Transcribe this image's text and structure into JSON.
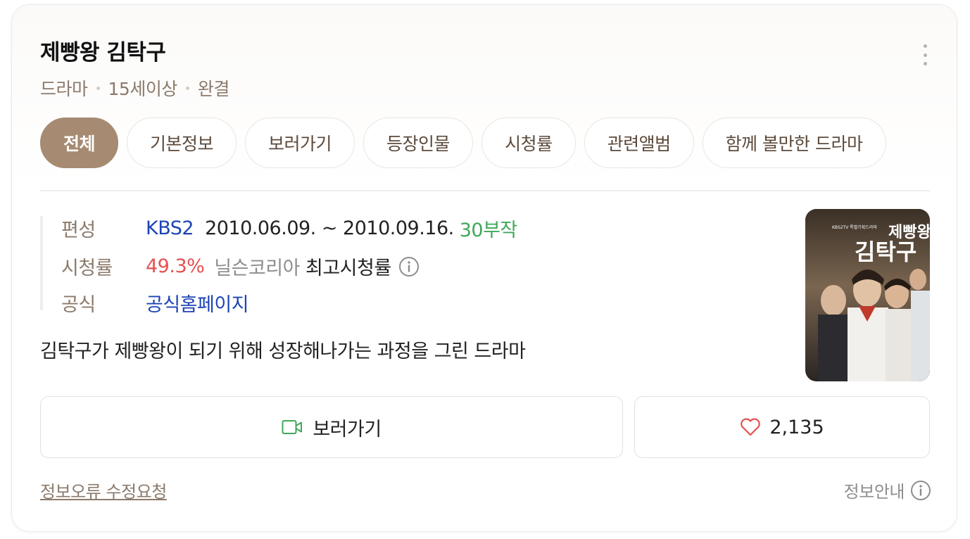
{
  "header": {
    "title": "제빵왕 김탁구",
    "meta": [
      "드라마",
      "15세이상",
      "완결"
    ]
  },
  "tabs": [
    {
      "label": "전체",
      "active": true
    },
    {
      "label": "기본정보",
      "active": false
    },
    {
      "label": "보러가기",
      "active": false
    },
    {
      "label": "등장인물",
      "active": false
    },
    {
      "label": "시청률",
      "active": false
    },
    {
      "label": "관련앨범",
      "active": false
    },
    {
      "label": "함께 볼만한 드라마",
      "active": false
    }
  ],
  "info": {
    "broadcast": {
      "label": "편성",
      "channel": "KBS2",
      "period": "2010.06.09. ~ 2010.09.16.",
      "episodes": "30부작"
    },
    "rating": {
      "label": "시청률",
      "value": "49.3%",
      "source": "닐슨코리아",
      "note": "최고시청률"
    },
    "official": {
      "label": "공식",
      "link": "공식홈페이지"
    }
  },
  "description": "김탁구가 제빵왕이 되기 위해 성장해나가는 과정을 그린 드라마",
  "poster": {
    "title_text": "제빵왕 김탁구",
    "channel_text": "KBS2TV 특별기획드라마"
  },
  "actions": {
    "watch_label": "보러가기",
    "like_count": "2,135"
  },
  "footer": {
    "report_label": "정보오류 수정요청",
    "guide_label": "정보안내"
  },
  "colors": {
    "accent": "#a68b72",
    "link_blue": "#1d44b4",
    "rating_red": "#e55050",
    "episode_green": "#3fa85a"
  }
}
